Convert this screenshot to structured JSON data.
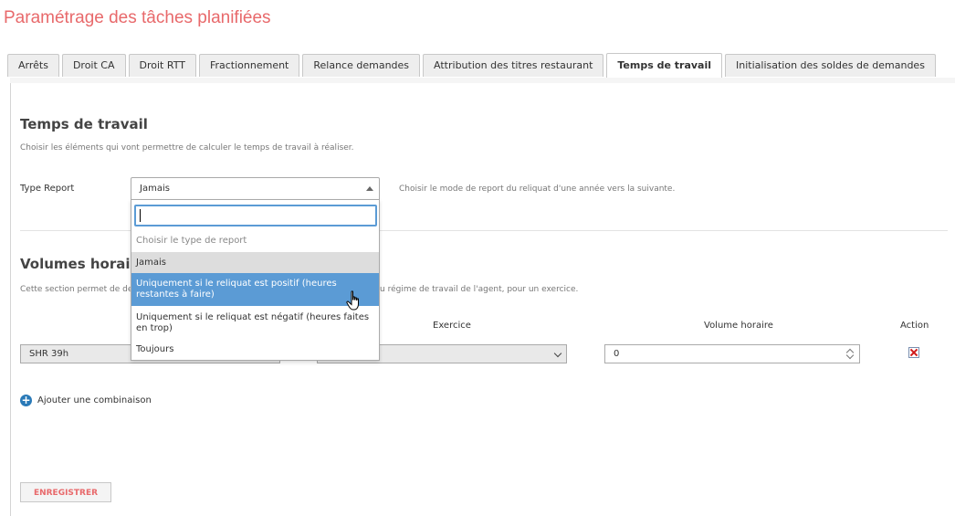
{
  "page_title": "Paramétrage des tâches planifiées",
  "tabs": [
    {
      "label": "Arrêts",
      "active": false
    },
    {
      "label": "Droit CA",
      "active": false
    },
    {
      "label": "Droit RTT",
      "active": false
    },
    {
      "label": "Fractionnement",
      "active": false
    },
    {
      "label": "Relance demandes",
      "active": false
    },
    {
      "label": "Attribution des titres restaurant",
      "active": false
    },
    {
      "label": "Temps de travail",
      "active": true
    },
    {
      "label": "Initialisation des soldes de demandes",
      "active": false
    }
  ],
  "temps_de_travail": {
    "title": "Temps de travail",
    "description": "Choisir les éléments qui vont permettre de calculer le temps de travail à réaliser.",
    "type_report_label": "Type Report",
    "type_report_value": "Jamais",
    "type_report_help": "Choisir le mode de report du reliquat d'une année vers la suivante."
  },
  "dropdown": {
    "search_value": "",
    "options": [
      {
        "label": "Choisir le type de report",
        "state": "placeholder"
      },
      {
        "label": "Jamais",
        "state": "selected"
      },
      {
        "label": "Uniquement si le reliquat est positif (heures restantes à faire)",
        "state": "hover"
      },
      {
        "label": "Uniquement si le reliquat est négatif (heures faites en trop)",
        "state": "normal"
      },
      {
        "label": "Toujours",
        "state": "normal"
      }
    ]
  },
  "volumes": {
    "title": "Volumes horair",
    "description_left": "Cette section permet de de",
    "description_right": "u régime de travail de l'agent, pour un exercice.",
    "columns": {
      "exercice": "Exercice",
      "volume": "Volume horaire",
      "action": "Action"
    },
    "row": {
      "regime": "SHR 39h",
      "exercice": "",
      "volume": "0"
    },
    "add_label": "Ajouter une combinaison"
  },
  "save_label": "ENREGISTRER",
  "colors": {
    "accent": "#e8696b",
    "highlight": "#5b9bd5",
    "delete": "#d01919",
    "add": "#2a7ab8"
  }
}
